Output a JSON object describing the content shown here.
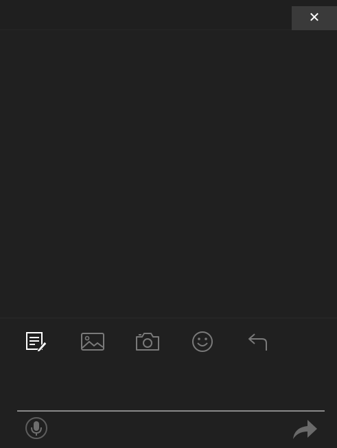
{
  "window": {
    "close_label": "✕"
  },
  "toolbar": {
    "tools": [
      {
        "name": "draw-text-tool",
        "icon": "edit-note-icon",
        "active": true
      },
      {
        "name": "image-tool",
        "icon": "image-icon",
        "active": false
      },
      {
        "name": "camera-tool",
        "icon": "camera-icon",
        "active": false
      },
      {
        "name": "emoji-tool",
        "icon": "smiley-icon",
        "active": false
      },
      {
        "name": "undo-tool",
        "icon": "undo-arrow-icon",
        "active": false
      }
    ]
  },
  "input": {
    "mic_icon": "microphone-icon",
    "send_icon": "send-arrow-icon"
  },
  "colors": {
    "background": "#202020",
    "active_icon": "#ffffff",
    "inactive_icon": "#7a7a7a",
    "close_bg": "#3a3a3a"
  }
}
